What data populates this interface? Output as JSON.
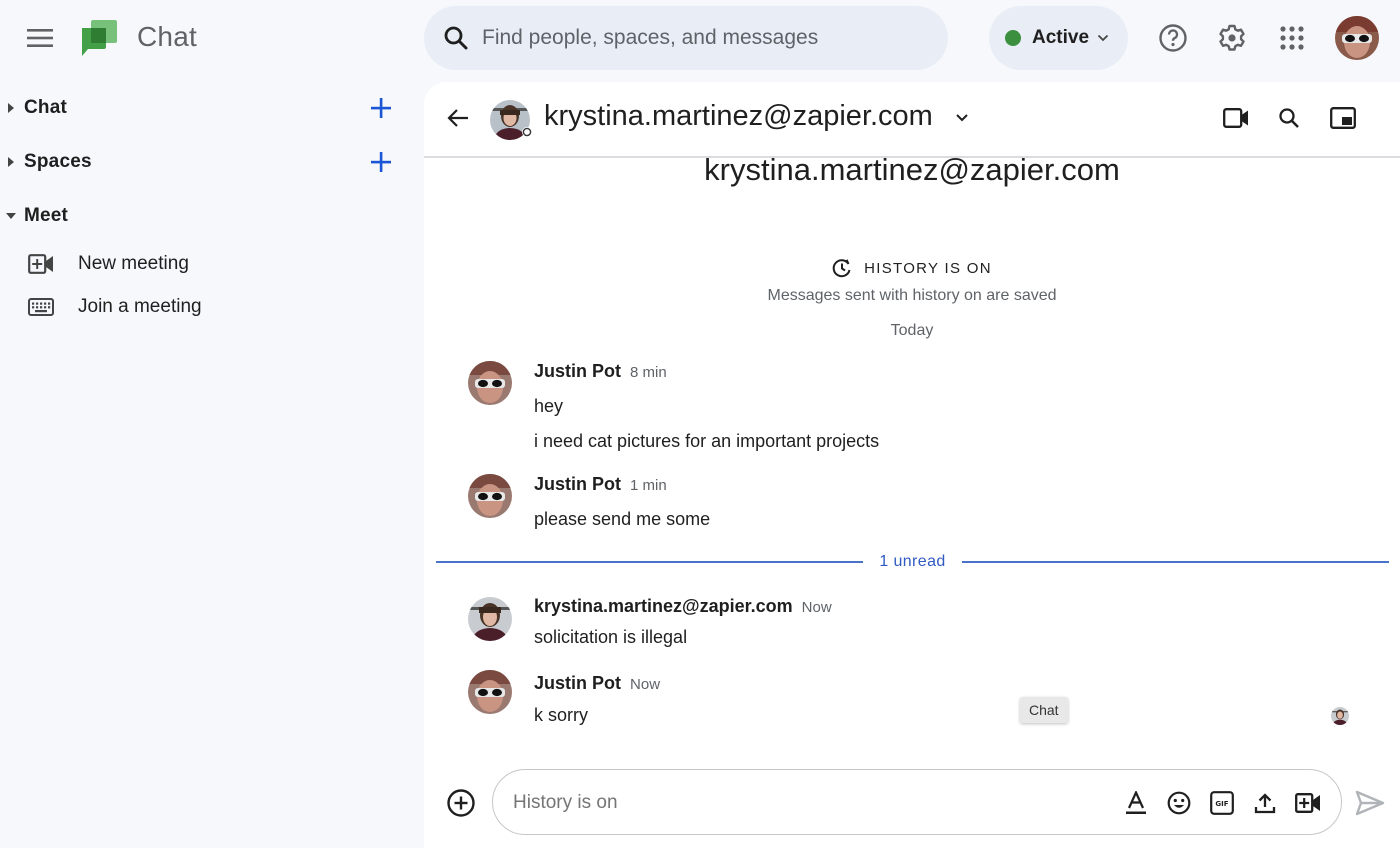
{
  "app": {
    "title": "Chat",
    "icons": {
      "menu": "hamburger-menu-icon",
      "logo": "google-chat-logo"
    }
  },
  "search": {
    "placeholder": "Find people, spaces, and messages",
    "value": "",
    "icon": "search-icon"
  },
  "status": {
    "label": "Active",
    "color": "#3b8f3f",
    "icon": "chevron-down-icon"
  },
  "toolbar": {
    "icons": [
      "help-icon",
      "settings-gear-icon",
      "apps-grid-icon",
      "account-avatar"
    ]
  },
  "sidebar": {
    "sections": [
      {
        "label": "Chat",
        "expanded": false,
        "has_add": true
      },
      {
        "label": "Spaces",
        "expanded": false,
        "has_add": true
      },
      {
        "label": "Meet",
        "expanded": true,
        "has_add": false
      }
    ],
    "meet_items": [
      {
        "label": "New meeting",
        "icon": "video-add-icon"
      },
      {
        "label": "Join a meeting",
        "icon": "keyboard-icon"
      }
    ],
    "accent_color": "#1a56d6"
  },
  "conversation": {
    "header": {
      "name": "krystina.martinez@zapier.com",
      "icons": [
        "back-arrow-icon",
        "chevron-down-icon",
        "video-call-icon",
        "search-icon",
        "picture-in-picture-icon"
      ]
    },
    "title": "krystina.martinez@zapier.com",
    "history": {
      "label": "HISTORY IS ON",
      "subtitle": "Messages sent with history on are saved"
    },
    "date_divider": "Today",
    "messages": [
      {
        "author": "Justin Pot",
        "time": "8 min",
        "lines": [
          "hey",
          "i need cat pictures for an important projects"
        ]
      },
      {
        "author": "Justin Pot",
        "time": "1 min",
        "lines": [
          "please send me some"
        ]
      },
      {
        "author": "krystina.martinez@zapier.com",
        "time": "Now",
        "lines": [
          "solicitation is illegal"
        ]
      },
      {
        "author": "Justin Pot",
        "time": "Now",
        "lines": [
          "k sorry"
        ]
      }
    ],
    "unread_divider": "1 unread",
    "unread_color": "#2f5bc1",
    "tooltip": "Chat"
  },
  "composer": {
    "placeholder": "History is on",
    "value": "",
    "icons": [
      "add-circle-icon",
      "text-format-icon",
      "emoji-icon",
      "gif-icon",
      "upload-icon",
      "video-meeting-icon",
      "send-icon"
    ]
  }
}
